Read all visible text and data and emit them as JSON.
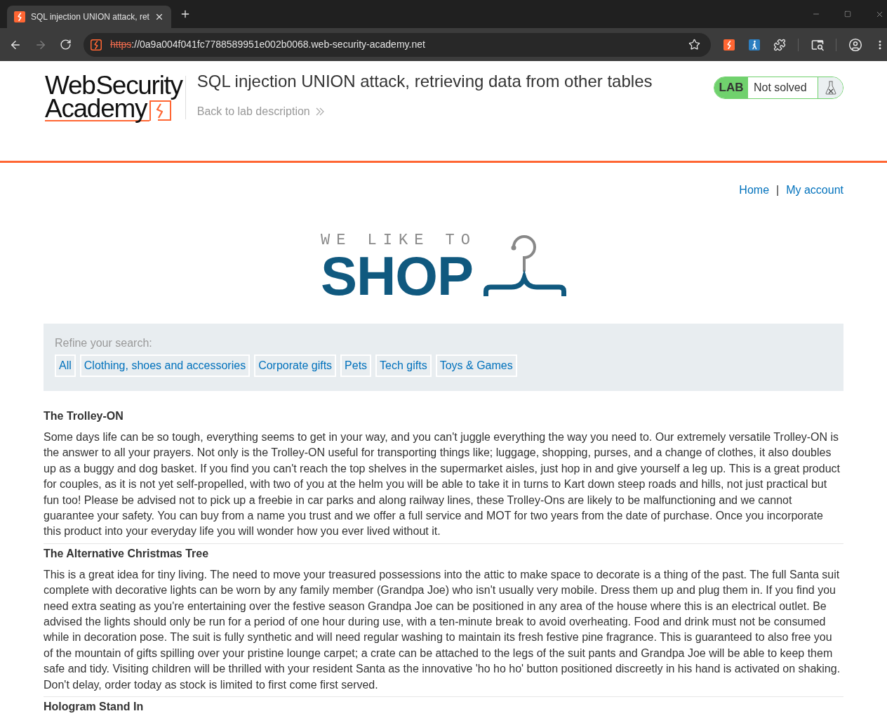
{
  "browser": {
    "tab": {
      "title": "SQL injection UNION attack, ret"
    },
    "forward": {
      "disabled": true
    },
    "address": {
      "scheme": "https",
      "rest": "://0a9a004f041fc7788589951e002b0068.web-security-academy.net",
      "not_secure": true
    }
  },
  "header": {
    "logo": {
      "line_1": "Web Security",
      "line_2": "Academy"
    },
    "title": "SQL injection UNION attack, retrieving data from other tables",
    "back_link": "Back to lab description",
    "lab_status": {
      "label": "LAB",
      "status": "Not solved",
      "solved": false
    }
  },
  "nav": {
    "links": [
      "Home",
      "My account"
    ],
    "separator": "|"
  },
  "shop_logo": {
    "tagline": "WE LIKE TO",
    "wordmark": "SHOP"
  },
  "search": {
    "label": "Refine your search:",
    "filters": [
      {
        "label": "All",
        "selected": false
      },
      {
        "label": "Clothing, shoes and accessories",
        "selected": false
      },
      {
        "label": "Corporate gifts",
        "selected": false
      },
      {
        "label": "Pets",
        "selected": false
      },
      {
        "label": "Tech gifts",
        "selected": false
      },
      {
        "label": "Toys & Games",
        "selected": false
      }
    ]
  },
  "products": [
    {
      "name": "The Trolley-ON",
      "description": "Some days life can be so tough, everything seems to get in your way, and you can't juggle everything the way you need to. Our extremely versatile Trolley-ON is the answer to all your prayers. Not only is the Trolley-ON useful for transporting things like; luggage, shopping, purses, and a change of clothes, it also doubles up as a buggy and dog basket. If you find you can't reach the top shelves in the supermarket aisles, just hop in and give yourself a leg up. This is a great product for couples, as it is not yet self-propelled, with two of you at the helm you will be able to take it in turns to Kart down steep roads and hills, not just practical but fun too! Please be advised not to pick up a freebie in car parks and along railway lines, these Trolley-Ons are likely to be malfunctioning and we cannot guarantee your safety. You can buy from a name you trust and we offer a full service and MOT for two years from the date of purchase. Once you incorporate this product into your everyday life you will wonder how you ever lived without it."
    },
    {
      "name": "The Alternative Christmas Tree",
      "description": "This is a great idea for tiny living. The need to move your treasured possessions into the attic to make space to decorate is a thing of the past. The full Santa suit complete with decorative lights can be worn by any family member (Grandpa Joe) who isn't usually very mobile. Dress them up and plug them in. If you find you need extra seating as you're entertaining over the festive season Grandpa Joe can be positioned in any area of the house where this is an electrical outlet. Be advised the lights should only be run for a period of one hour during use, with a ten-minute break to avoid overheating. Food and drink must not be consumed while in decoration pose. The suit is fully synthetic and will need regular washing to maintain its fresh festive pine fragrance. This is guaranteed to also free you of the mountain of gifts spilling over your pristine lounge carpet; a crate can be attached to the legs of the suit pants and Grandpa Joe will be able to keep them safe and tidy. Visiting children will be thrilled with your resident Santa as the innovative 'ho ho ho' button positioned discreetly in his hand is activated on shaking. Don't delay, order today as stock is limited to first come first served."
    },
    {
      "name": "Hologram Stand In"
    }
  ]
}
